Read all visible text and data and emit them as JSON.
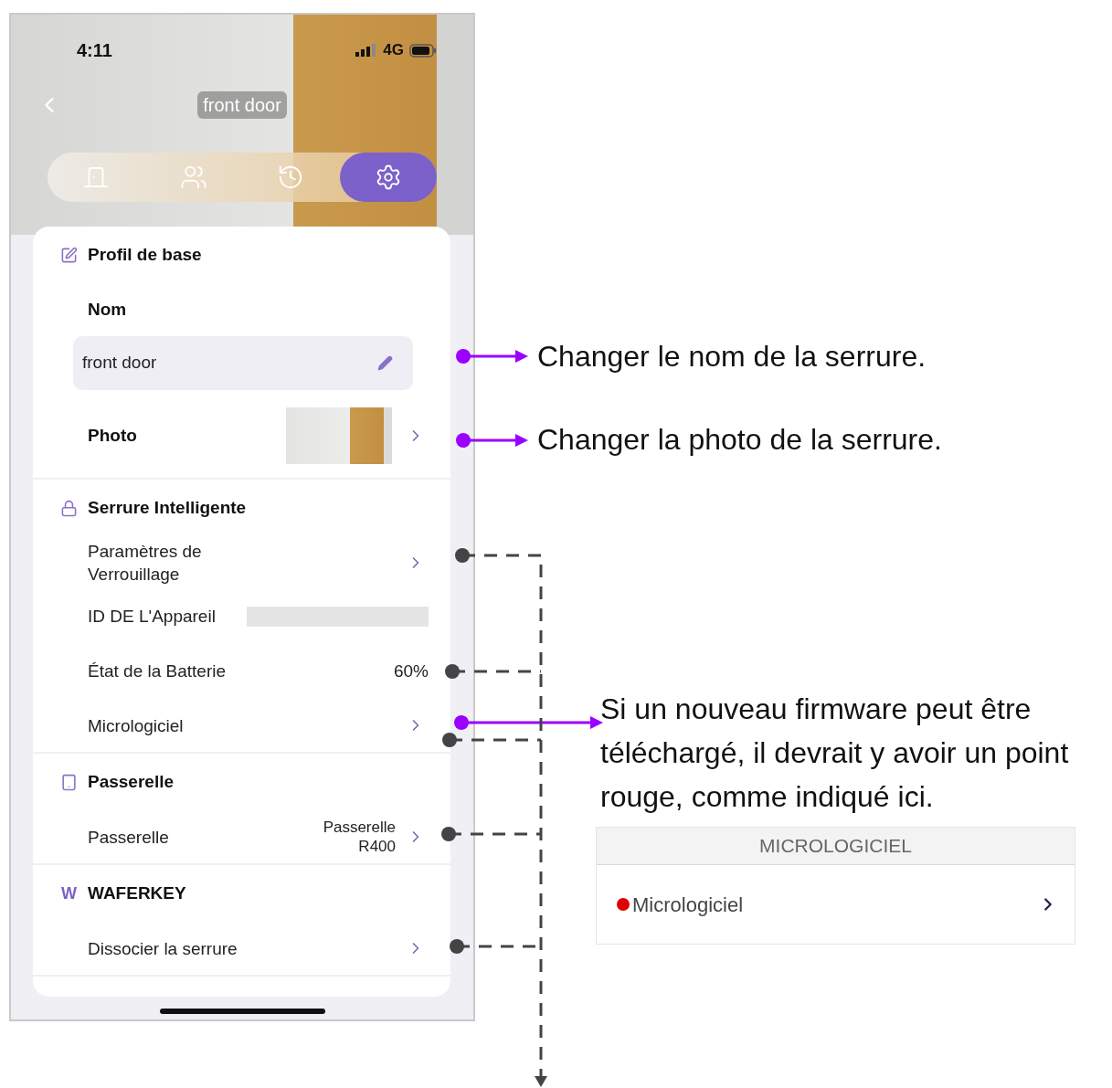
{
  "status_bar": {
    "time": "4:11",
    "network": "4G"
  },
  "nav": {
    "title": "front door"
  },
  "tabs": [
    {
      "kind": "door",
      "selected": false
    },
    {
      "kind": "users",
      "selected": false
    },
    {
      "kind": "history",
      "selected": false
    },
    {
      "kind": "settings",
      "selected": true
    }
  ],
  "sections": [
    {
      "kind": "edit",
      "title": "Profil de base",
      "rows": [
        {
          "kind": "label",
          "label": "Nom"
        },
        {
          "kind": "field",
          "value": "front door"
        },
        {
          "kind": "photo",
          "label": "Photo"
        }
      ]
    },
    {
      "kind": "lock",
      "title": "Serrure Intelligente",
      "rows": [
        {
          "kind": "link",
          "label": "Paramètres de Verrouillage"
        },
        {
          "kind": "redacted",
          "label": "ID DE L'Appareil"
        },
        {
          "kind": "value",
          "label": "État de la Batterie",
          "value": "60%"
        },
        {
          "kind": "link",
          "label": "Micrologiciel"
        }
      ]
    },
    {
      "kind": "gateway",
      "title": "Passerelle",
      "rows": [
        {
          "kind": "link",
          "label": "Passerelle",
          "value": "Passerelle R400"
        }
      ]
    },
    {
      "kind": "letter",
      "icon_text": "W",
      "title": "WAFERKEY",
      "rows": [
        {
          "kind": "link",
          "label": "Dissocier la serrure"
        }
      ]
    }
  ],
  "annotations": [
    {
      "text": "Changer le nom de la serrure."
    },
    {
      "text": "Changer la photo de la serrure."
    },
    {
      "text": "Si un nouveau firmware peut être téléchargé, il devrait y avoir un point rouge, comme indiqué ici."
    }
  ],
  "inset": {
    "header": "MICROLOGICIEL",
    "label": "Micrologiciel",
    "color": "#e00000"
  }
}
